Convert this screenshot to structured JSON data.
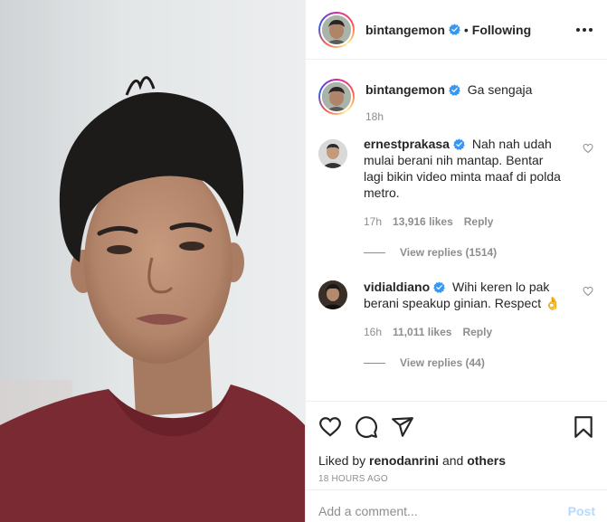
{
  "post": {
    "author": "bintangemon",
    "verified": true,
    "separator": "•",
    "follow_status": "Following",
    "more_icon": "more-horizontal-icon"
  },
  "caption": {
    "user": "bintangemon",
    "text": "Ga sengaja",
    "time": "18h"
  },
  "comments": [
    {
      "user": "ernestprakasa",
      "verified": true,
      "text": "Nah nah udah mulai berani nih mantap. Bentar lagi bikin video minta maaf di polda metro.",
      "time": "17h",
      "likes": "13,916 likes",
      "reply": "Reply",
      "view_replies": "View replies (1514)"
    },
    {
      "user": "vidialdiano",
      "verified": true,
      "text": "Wihi keren lo pak berani speakup ginian. Respect 👌",
      "time": "16h",
      "likes": "11,011 likes",
      "reply": "Reply",
      "view_replies": "View replies (44)"
    }
  ],
  "actions": {
    "icons": [
      "heart-icon",
      "comment-icon",
      "share-icon",
      "bookmark-icon"
    ],
    "liked_by_prefix": "Liked by",
    "liked_by_user": "renodanrini",
    "liked_by_and": "and",
    "liked_by_others": "others",
    "timestamp": "18 HOURS AGO"
  },
  "add_comment": {
    "placeholder": "Add a comment...",
    "post_label": "Post"
  },
  "colors": {
    "verified": "#3897f0",
    "muted": "#8e8e8e",
    "post_button_disabled": "#b3dbff",
    "shirt": "#7a2a32"
  }
}
